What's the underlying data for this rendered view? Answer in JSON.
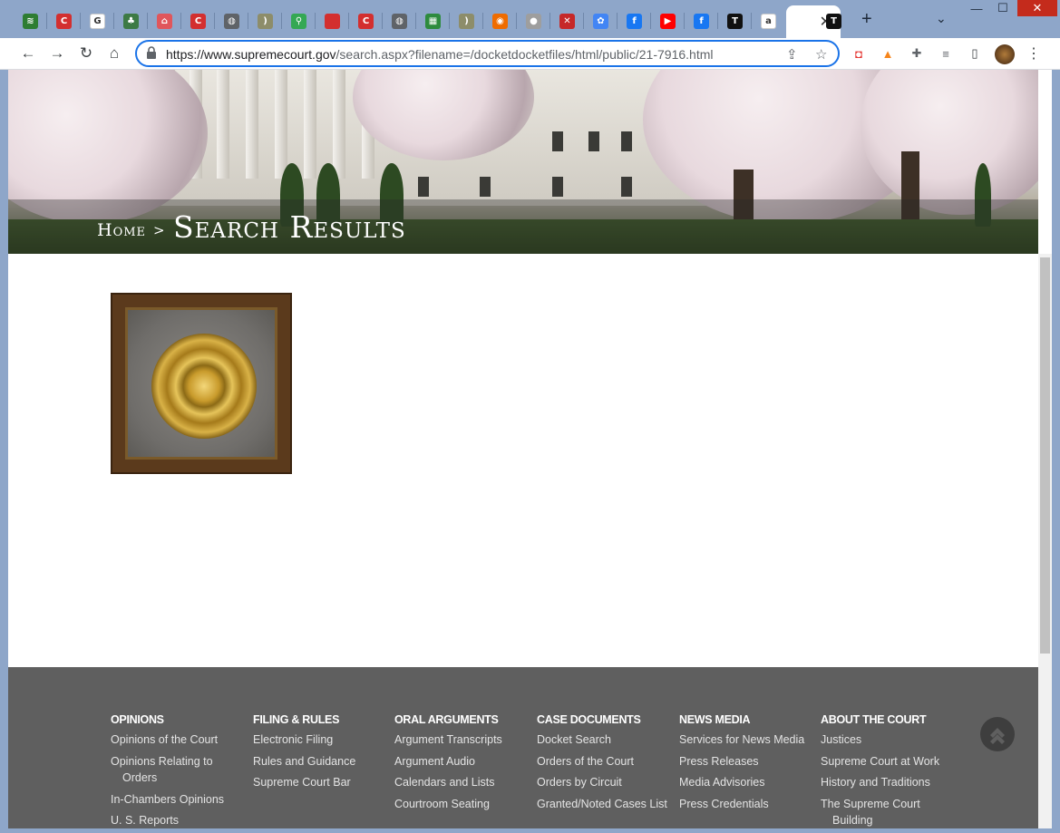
{
  "browser": {
    "tabs": [
      {
        "icon": "feedly-icon",
        "color": "#2e7d32",
        "glyph": "≋"
      },
      {
        "icon": "c-logo-icon",
        "color": "#d32f2f",
        "glyph": "C"
      },
      {
        "icon": "google-icon",
        "color": "#ffffff",
        "glyph": "G"
      },
      {
        "icon": "tree-icon",
        "color": "#3d7a45",
        "glyph": "♣"
      },
      {
        "icon": "airbnb-icon",
        "color": "#e0565b",
        "glyph": "⌂"
      },
      {
        "icon": "c-logo-icon",
        "color": "#d32f2f",
        "glyph": "C"
      },
      {
        "icon": "globe-icon",
        "color": "#5f6368",
        "glyph": "◍"
      },
      {
        "icon": "counter-icon",
        "color": "#8d8d6a",
        "glyph": ")"
      },
      {
        "icon": "google-maps-icon",
        "color": "#34a853",
        "glyph": "⚲"
      },
      {
        "icon": "jf-icon",
        "color": "#d32f2f",
        "glyph": ""
      },
      {
        "icon": "c-logo-icon",
        "color": "#d32f2f",
        "glyph": "C"
      },
      {
        "icon": "globe-icon",
        "color": "#5f6368",
        "glyph": "◍"
      },
      {
        "icon": "green-square-icon",
        "color": "#2e8b3e",
        "glyph": "▦"
      },
      {
        "icon": "counter-icon",
        "color": "#8d8d6a",
        "glyph": ")"
      },
      {
        "icon": "orange-camera-icon",
        "color": "#ef6c00",
        "glyph": "◉"
      },
      {
        "icon": "gray-circle-icon",
        "color": "#9e9e9e",
        "glyph": "●"
      },
      {
        "icon": "cross-tools-icon",
        "color": "#c62828",
        "glyph": "✕"
      },
      {
        "icon": "google-photos-icon",
        "color": "#4285f4",
        "glyph": "✿"
      },
      {
        "icon": "facebook-icon",
        "color": "#1877f2",
        "glyph": "f"
      },
      {
        "icon": "youtube-icon",
        "color": "#ff0000",
        "glyph": "▶"
      },
      {
        "icon": "facebook-icon",
        "color": "#1877f2",
        "glyph": "f"
      },
      {
        "icon": "t-logo-icon",
        "color": "#111111",
        "glyph": "T"
      },
      {
        "icon": "amazon-icon",
        "color": "#ffffff",
        "glyph": "a"
      }
    ],
    "active_tab_close": "✕",
    "last_tab_glyph": "T",
    "new_tab": "+",
    "window_min": "—",
    "window_max": "☐",
    "window_close": "✕",
    "url_host": "https://www.supremecourt.gov",
    "url_path": "/search.aspx?filename=/docketdocketfiles/html/public/21-7916.html"
  },
  "page": {
    "breadcrumb_home": "Home",
    "breadcrumb_sep": ">",
    "title": "Search Results"
  },
  "footer": {
    "columns": [
      {
        "heading": "OPINIONS",
        "links": [
          "Opinions of the Court",
          "Opinions Relating to Orders",
          "In-Chambers Opinions",
          "U. S. Reports"
        ]
      },
      {
        "heading": "FILING & RULES",
        "links": [
          "Electronic Filing",
          "Rules and Guidance",
          "Supreme Court Bar"
        ]
      },
      {
        "heading": "ORAL ARGUMENTS",
        "links": [
          "Argument Transcripts",
          "Argument Audio",
          "Calendars and Lists",
          "Courtroom Seating"
        ]
      },
      {
        "heading": "CASE DOCUMENTS",
        "links": [
          "Docket Search",
          "Orders of the Court",
          "Orders by Circuit",
          "Granted/Noted Cases List"
        ]
      },
      {
        "heading": "NEWS MEDIA",
        "links": [
          "Services for News Media",
          "Press Releases",
          "Media Advisories",
          "Press Credentials"
        ]
      },
      {
        "heading": "ABOUT THE COURT",
        "links": [
          "Justices",
          "Supreme Court at Work",
          "History and Traditions",
          "The Supreme Court Building"
        ]
      }
    ]
  }
}
